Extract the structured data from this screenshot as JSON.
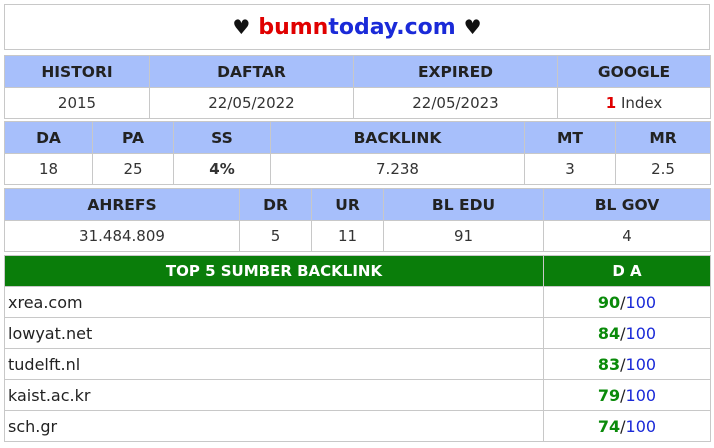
{
  "header": {
    "heart_left": "♥",
    "domain_part1": "bumn",
    "domain_part2": "today.com",
    "heart_right": "♥"
  },
  "table1": {
    "headers": [
      "HISTORI",
      "DAFTAR",
      "EXPIRED",
      "GOOGLE"
    ],
    "values": {
      "histori": "2015",
      "daftar": "22/05/2022",
      "expired": "22/05/2023",
      "google_count": "1",
      "google_label": "Index"
    }
  },
  "table2": {
    "headers": [
      "DA",
      "PA",
      "SS",
      "BACKLINK",
      "MT",
      "MR"
    ],
    "values": [
      "18",
      "25",
      "4%",
      "7.238",
      "3",
      "2.5"
    ]
  },
  "table3": {
    "headers": [
      "AHREFS",
      "DR",
      "UR",
      "BL EDU",
      "BL GOV"
    ],
    "values": [
      "31.484.809",
      "5",
      "11",
      "91",
      "4"
    ]
  },
  "backlinks": {
    "header_source": "TOP 5 SUMBER BACKLINK",
    "header_da": "D A",
    "separator": "/",
    "max": "100",
    "rows": [
      {
        "site": "xrea.com",
        "score": "90"
      },
      {
        "site": "lowyat.net",
        "score": "84"
      },
      {
        "site": "tudelft.nl",
        "score": "83"
      },
      {
        "site": "kaist.ac.kr",
        "score": "79"
      },
      {
        "site": "sch.gr",
        "score": "74"
      }
    ]
  },
  "colors": {
    "header_bg": "#a7bffb",
    "backlink_header_bg": "#0a7d0a",
    "domain_red": "#e00000",
    "domain_blue": "#1a2ad8",
    "score_green": "#0a8a0a"
  }
}
